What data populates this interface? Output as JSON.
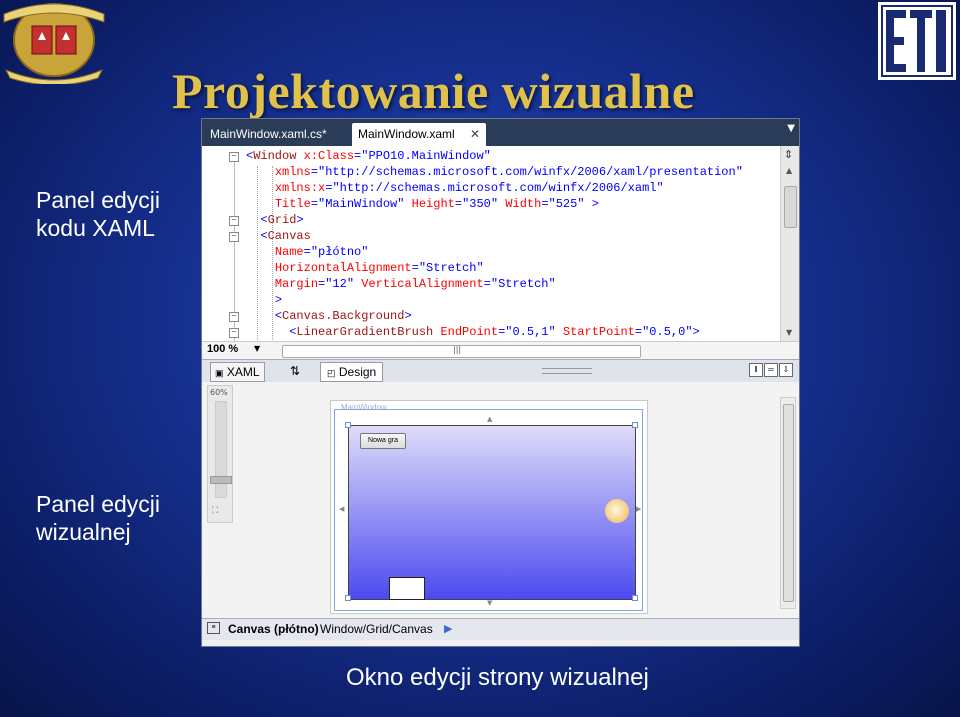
{
  "slide": {
    "title": "Projektowanie wizualne",
    "label_xaml": [
      "Panel edycji",
      "kodu XAML"
    ],
    "label_visual": [
      "Panel edycji",
      "wizualnej"
    ],
    "label_bottom": "Okno edycji strony wizualnej"
  },
  "ide": {
    "tabs": [
      {
        "label": "MainWindow.xaml.cs*",
        "active": false
      },
      {
        "label": "MainWindow.xaml",
        "active": true
      }
    ],
    "code_lines": [
      {
        "fold": "−",
        "text": "<Window x:Class=\"PPO10.MainWindow\""
      },
      {
        "fold": "",
        "text": "    xmlns=\"http://schemas.microsoft.com/winfx/2006/xaml/presentation\""
      },
      {
        "fold": "",
        "text": "    xmlns:x=\"http://schemas.microsoft.com/winfx/2006/xaml\""
      },
      {
        "fold": "",
        "text": "    Title=\"MainWindow\" Height=\"350\" Width=\"525\" >"
      },
      {
        "fold": "−",
        "text": "  <Grid>"
      },
      {
        "fold": "−",
        "text": "  <Canvas"
      },
      {
        "fold": "",
        "text": "    Name=\"płótno\""
      },
      {
        "fold": "",
        "text": "    HorizontalAlignment=\"Stretch\""
      },
      {
        "fold": "",
        "text": "    Margin=\"12\" VerticalAlignment=\"Stretch\""
      },
      {
        "fold": "",
        "text": "    >"
      },
      {
        "fold": "−",
        "text": "    <Canvas.Background>"
      },
      {
        "fold": "−",
        "text": "      <LinearGradientBrush EndPoint=\"0.5,1\" StartPoint=\"0.5,0\">"
      }
    ],
    "zoom_value": "100 %",
    "split_tabs": {
      "xaml": "XAML",
      "swap": "⇅",
      "design": "Design"
    },
    "designer_zoom": "60%",
    "window_title": "MainWindow",
    "new_game_button": "Nowa gra",
    "status_element": "Canvas (płótno)",
    "status_path": "Window/Grid/Canvas"
  },
  "colors": {
    "title": "#e0c24a",
    "tab_bar": "#2b3c58",
    "canvas_top": "#dedcf8",
    "canvas_bottom": "#4d4af0"
  }
}
